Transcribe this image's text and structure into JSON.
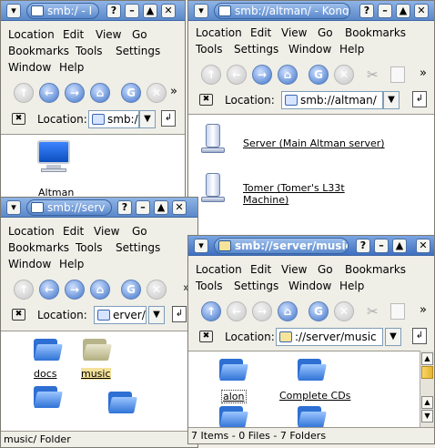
{
  "win1": {
    "title": "smb:/ - I",
    "menu": [
      "Location",
      "Edit",
      "View",
      "Go",
      "Bookmarks",
      "Tools",
      "Settings",
      "Window",
      "Help"
    ],
    "location_label": "Location:",
    "location_value": "smb:/",
    "items": [
      {
        "label": "Altman",
        "icon": "monitor-icon"
      }
    ]
  },
  "win2": {
    "title": "smb://altman/ - Konq",
    "menu": [
      "Location",
      "Edit",
      "View",
      "Go",
      "Bookmarks",
      "Tools",
      "Settings",
      "Window",
      "Help"
    ],
    "location_label": "Location:",
    "location_value": "smb://altman/",
    "items": [
      {
        "label": "Server (Main Altman server)",
        "icon": "server-icon"
      },
      {
        "label": "Tomer (Tomer's L33t Machine)",
        "icon": "server-icon"
      }
    ]
  },
  "win3": {
    "title": "smb://serv",
    "menu": [
      "Location",
      "Edit",
      "View",
      "Go",
      "Bookmarks",
      "Tools",
      "Settings",
      "Window",
      "Help"
    ],
    "location_label": "Location:",
    "location_value": "erver/",
    "items": [
      {
        "label": "docs",
        "selected": false
      },
      {
        "label": "music",
        "selected": true
      },
      {
        "label": "",
        "selected": false
      },
      {
        "label": "",
        "selected": false
      }
    ],
    "status": "music/  Folder"
  },
  "win4": {
    "title": "smb://server/music",
    "menu": [
      "Location",
      "Edit",
      "View",
      "Go",
      "Bookmarks",
      "Tools",
      "Settings",
      "Window",
      "Help"
    ],
    "location_label": "Location:",
    "location_value": "://server/music",
    "items": [
      {
        "label": "alon"
      },
      {
        "label": "Complete CDs"
      }
    ],
    "status": "7 Items - 0 Files - 7 Folders"
  },
  "buttons": {
    "menu": "▾",
    "help": "?",
    "minimize": "–",
    "maximize": "▲",
    "close": "✕",
    "more": "»",
    "clear": "✖",
    "dropdown": "▼",
    "go": "↲"
  },
  "colors": {
    "titlebar": "#5b88c9",
    "titlebar_active": "#3e6fc0",
    "folder": "#2f72d6",
    "selection": "#f3e29a"
  }
}
